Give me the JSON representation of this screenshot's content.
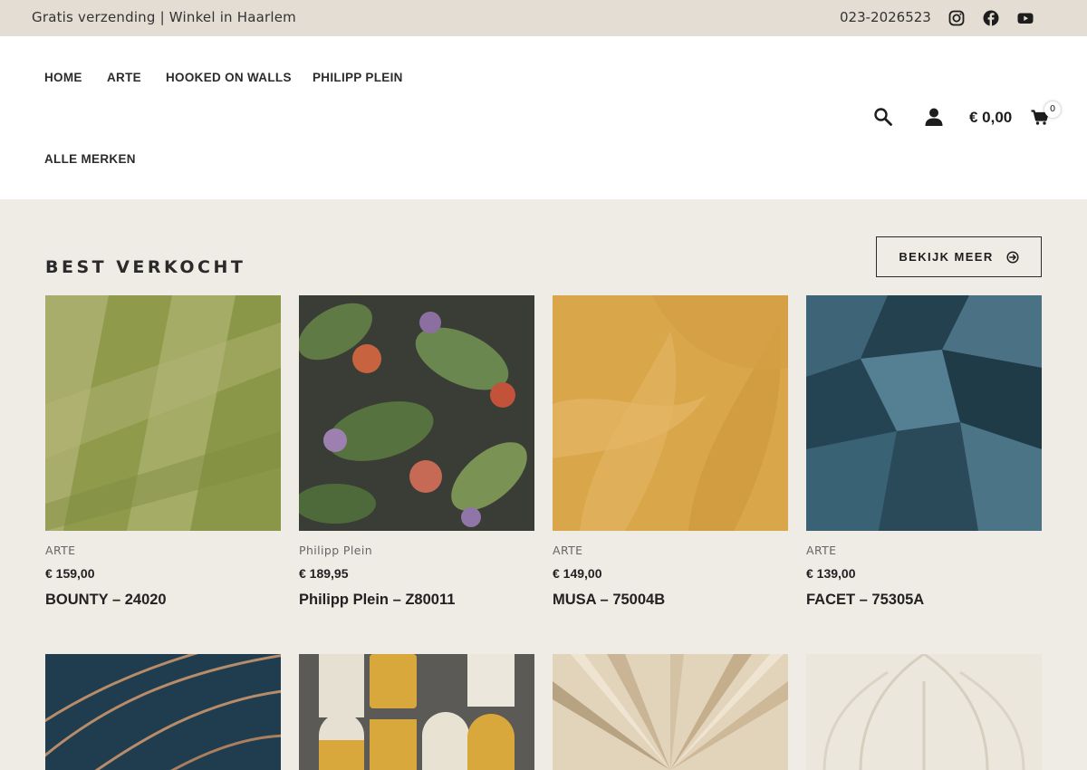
{
  "topbar": {
    "promo": "Gratis verzending | Winkel in Haarlem",
    "phone": "023-2026523",
    "social": [
      "instagram-icon",
      "facebook-icon",
      "youtube-icon"
    ]
  },
  "nav": {
    "items": [
      {
        "label": "HOME"
      },
      {
        "label": "ARTE"
      },
      {
        "label": "HOOKED ON WALLS"
      },
      {
        "label": "PHILIPP PLEIN"
      },
      {
        "label": "ALLE MERKEN"
      }
    ]
  },
  "header": {
    "cart_total": "€ 0,00",
    "cart_count": "0",
    "icons": [
      "search-icon",
      "user-icon",
      "cart-icon"
    ]
  },
  "section": {
    "title": "BEST VERKOCHT",
    "more_label": "BEKIJK MEER"
  },
  "products": [
    {
      "brand": "ARTE",
      "price": "€ 159,00",
      "name": "BOUNTY – 24020"
    },
    {
      "brand": "Philipp Plein",
      "price": "€ 189,95",
      "name": "Philipp Plein – Z80011"
    },
    {
      "brand": "ARTE",
      "price": "€ 149,00",
      "name": "MUSA – 75004B"
    },
    {
      "brand": "ARTE",
      "price": "€ 139,00",
      "name": "FACET – 75305A"
    }
  ],
  "colors": {
    "topbar_bg": "#e3ddd3",
    "page_bg": "#efebe5",
    "text": "#222222"
  }
}
